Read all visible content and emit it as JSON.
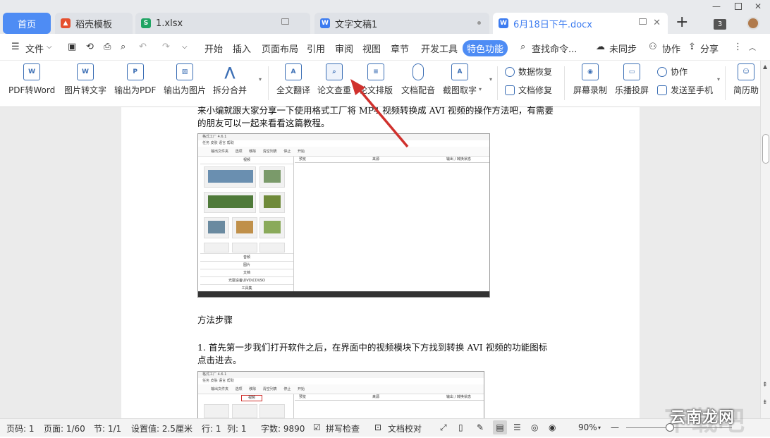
{
  "tabs": [
    {
      "label": "首页"
    },
    {
      "label": "稻壳模板"
    },
    {
      "label": "1.xlsx"
    },
    {
      "label": "文字文稿1"
    },
    {
      "label": "6月18日下午.docx"
    }
  ],
  "tab_count": "3",
  "menu": {
    "file": "文件",
    "items": [
      "开始",
      "插入",
      "页面布局",
      "引用",
      "审阅",
      "视图",
      "章节",
      "开发工具",
      "特色功能"
    ],
    "search": "查找命令...",
    "sync": "未同步",
    "collab": "协作",
    "share": "分享"
  },
  "toolbar": {
    "items": [
      "PDF转Word",
      "图片转文字",
      "输出为PDF",
      "输出为图片",
      "拆分合并",
      "全文翻译",
      "论文查重",
      "论文排版",
      "文档配音",
      "截图取字"
    ],
    "small": [
      "数据恢复",
      "文档修复",
      "协作",
      "发送至手机"
    ],
    "more": [
      "屏幕录制",
      "乐播投屏",
      "简历助"
    ]
  },
  "doc": {
    "para1_line1": "来小编就跟大家分享一下使用格式工厂将 MP4 视频转换成 AVI 视频的操作方法吧，有需要",
    "para1_line2": "的朋友可以一起来看看这篇教程。",
    "heading": "方法步骤",
    "para2_line1": "1. 首先第一步我们打开软件之后，在界面中的视频模块下方找到转换 AVI 视频的功能图标",
    "para2_line2": "点击进去。"
  },
  "shot": {
    "title": "格式工厂 4.6.1",
    "menu": "任务  皮肤  语言  帮助",
    "toolbar": "输出文件夹  选项  移除  清空列表  停止  开始",
    "col_preview": "预览",
    "col_source": "来源",
    "col_output": "输出 / 转换状态",
    "section": "视频",
    "rows": [
      "音频",
      "图片",
      "文档",
      "光驱设备\\DVD\\CD\\ISO",
      "工具集"
    ],
    "highlight": "视频"
  },
  "status": {
    "page_num": "页码: 1",
    "pages": "页面: 1/60",
    "section": "节: 1/1",
    "setting": "设置值: 2.5厘米",
    "row": "行: 1",
    "col": "列: 1",
    "words": "字数: 9890",
    "spell": "拼写检查",
    "proof": "文档校对",
    "zoom": "90%"
  },
  "watermark": "云南龙网",
  "colors": {
    "accent": "#4e8cf4",
    "arrow": "#d0312d"
  }
}
